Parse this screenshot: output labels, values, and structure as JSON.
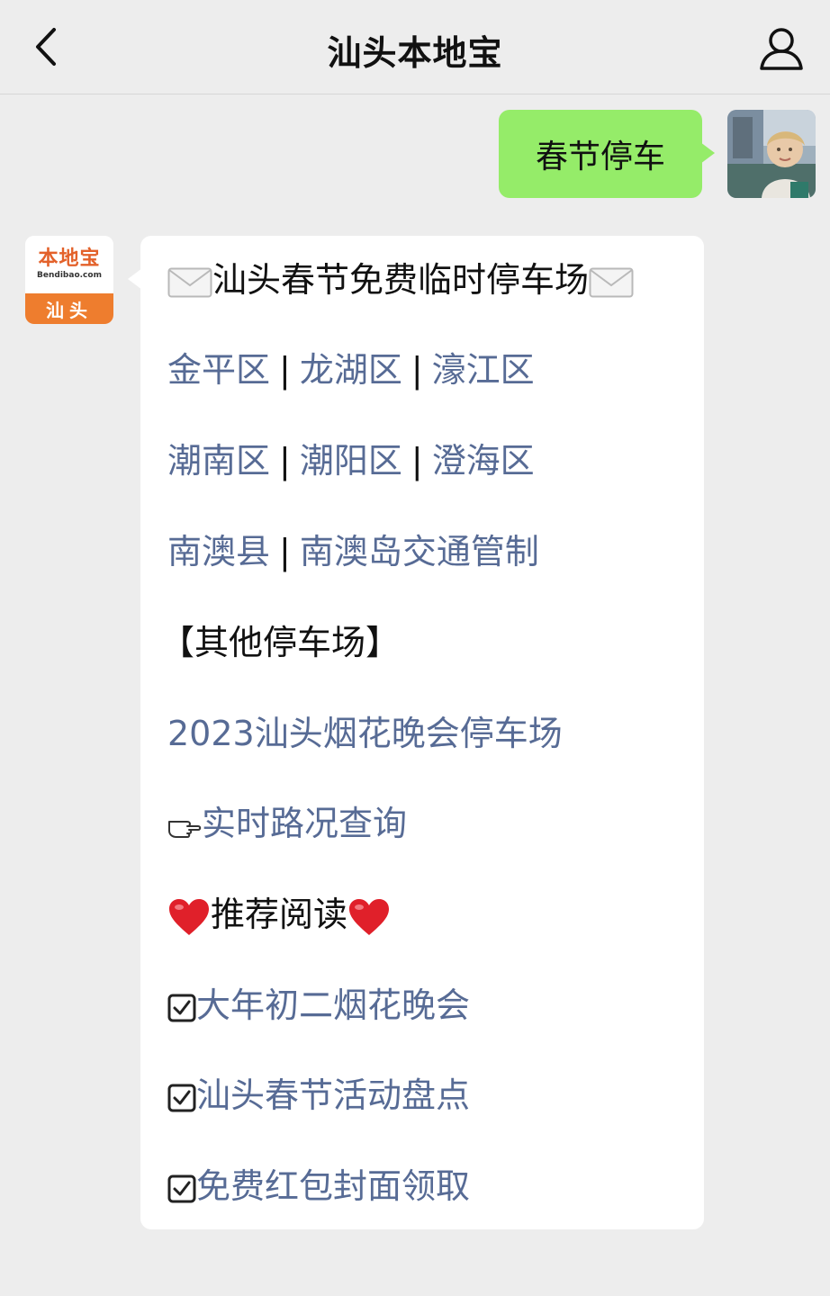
{
  "header": {
    "title": "汕头本地宝"
  },
  "outgoing": {
    "text": "春节停车"
  },
  "bot_avatar": {
    "brand": "本地宝",
    "domain": "Bendibao.com",
    "city": "汕头"
  },
  "message": {
    "title": "汕头春节免费临时停车场",
    "row1": [
      "金平区",
      "龙湖区",
      "濠江区"
    ],
    "row2": [
      "潮南区",
      "潮阳区",
      "澄海区"
    ],
    "row3": [
      "南澳县",
      "南澳岛交通管制"
    ],
    "separator": "|",
    "other_heading": "【其他停车场】",
    "fireworks_link": "2023汕头烟花晚会停车场",
    "traffic_link": "实时路况查询",
    "recommend_heading": "推荐阅读",
    "recommend": [
      "大年初二烟花晚会",
      "汕头春节活动盘点",
      "免费红包封面领取"
    ]
  },
  "icons": {
    "back": "chevron-left-icon",
    "profile": "person-icon",
    "envelope": "envelope-icon",
    "pointing": "pointing-hand-icon",
    "heart": "heart-icon",
    "check": "checkbox-icon"
  },
  "colors": {
    "link": "#576b95",
    "outgoing_bubble": "#95ec69",
    "background": "#ededed",
    "brand_orange": "#ee7d2e",
    "heart": "#e0202a"
  }
}
